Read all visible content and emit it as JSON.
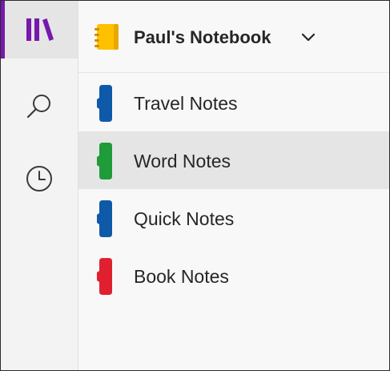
{
  "colors": {
    "accent": "#7719aa",
    "notebook_icon": "#ffc000"
  },
  "rail": {
    "items": [
      {
        "name": "notebooks",
        "icon": "library-icon",
        "active": true
      },
      {
        "name": "search",
        "icon": "search-icon",
        "active": false
      },
      {
        "name": "recent",
        "icon": "clock-icon",
        "active": false
      }
    ]
  },
  "notebook": {
    "title": "Paul's Notebook",
    "icon": "notebook-icon",
    "dropdown_icon": "chevron-down-icon"
  },
  "sections": [
    {
      "label": "Travel Notes",
      "color": "#0f5aa8",
      "selected": false
    },
    {
      "label": "Word Notes",
      "color": "#1f9b3a",
      "selected": true
    },
    {
      "label": "Quick Notes",
      "color": "#0f5aa8",
      "selected": false
    },
    {
      "label": "Book Notes",
      "color": "#e1202f",
      "selected": false
    }
  ]
}
